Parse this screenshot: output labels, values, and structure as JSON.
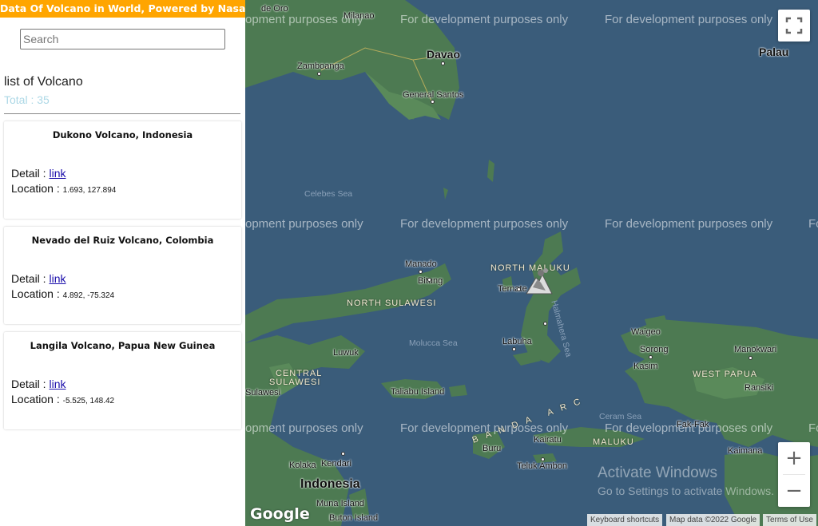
{
  "header": {
    "title": "Data Of Volcano in World, Powered by Nasa"
  },
  "search": {
    "placeholder": "Search",
    "value": ""
  },
  "list": {
    "title": "list of Volcano",
    "total_label": "Total : 35",
    "items": [
      {
        "name": "Dukono Volcano, Indonesia",
        "detail_label": "Detail :",
        "link_text": "link",
        "location_label": "Location :",
        "coords": "1.693, 127.894"
      },
      {
        "name": "Nevado del Ruiz Volcano, Colombia",
        "detail_label": "Detail :",
        "link_text": "link",
        "location_label": "Location :",
        "coords": "4.892, -75.324"
      },
      {
        "name": "Langila Volcano, Papua New Guinea",
        "detail_label": "Detail :",
        "link_text": "link",
        "location_label": "Location :",
        "coords": "-5.525, 148.42"
      }
    ]
  },
  "map": {
    "watermark": "For development purposes only",
    "watermark_cut_left": "opment purposes only",
    "watermark_cut_right": "Fo",
    "labels": {
      "de_oro": "de Oro",
      "milanao": "Milanao",
      "davao": "Davao",
      "zamboanga": "Zamboanga",
      "palau": "Palau",
      "general_santos": "General Santos",
      "celebes_sea": "Celebes Sea",
      "manado": "Manado",
      "bitung": "Bitung",
      "north_maluku": "NORTH MALUKU",
      "ternate": "Ternate",
      "halmahera_sea": "Halmahera Sea",
      "north_sulawesi": "NORTH SULAWESI",
      "waigeo": "Waigeo",
      "molucca_sea": "Molucca Sea",
      "labuha": "Labuha",
      "sorong": "Sorong",
      "manokwari": "Manokwari",
      "luwuk": "Luwuk",
      "kasim": "Kasim",
      "central_sulawesi": "CENTRAL",
      "central_sulawesi2": "SULAWESI",
      "west_papua": "WEST PAPUA",
      "sulawesi": "Sulawesi",
      "taliabu": "Taliabu Island",
      "ransiki": "Ransiki",
      "ceram_sea": "Ceram Sea",
      "banda_arc": "BANDA ARC",
      "fak_fak": "Fak-Fak",
      "kairatu": "Kairatu",
      "maluku": "MALUKU",
      "buru": "Buru",
      "kaimana": "Kaimana",
      "kolaka": "Kolaka",
      "kendari": "Kendari",
      "teluk_ambon": "Teluk Ambon",
      "indonesia": "Indonesia",
      "muna_island": "Muna Island",
      "buton_island": "Buton Island"
    },
    "activate_title": "Activate Windows",
    "activate_sub": "Go to Settings to activate Windows.",
    "google_logo": "Google",
    "attribution": {
      "shortcuts": "Keyboard shortcuts",
      "data": "Map data ©2022 Google",
      "terms": "Terms of Use"
    },
    "zoom_in": "+",
    "zoom_out": "−",
    "fullscreen_icon": "fullscreen-icon",
    "colors": {
      "water": "#3a5c7a",
      "land": "#4d7a52",
      "header": "#ffa500",
      "total": "#add8e6"
    }
  }
}
